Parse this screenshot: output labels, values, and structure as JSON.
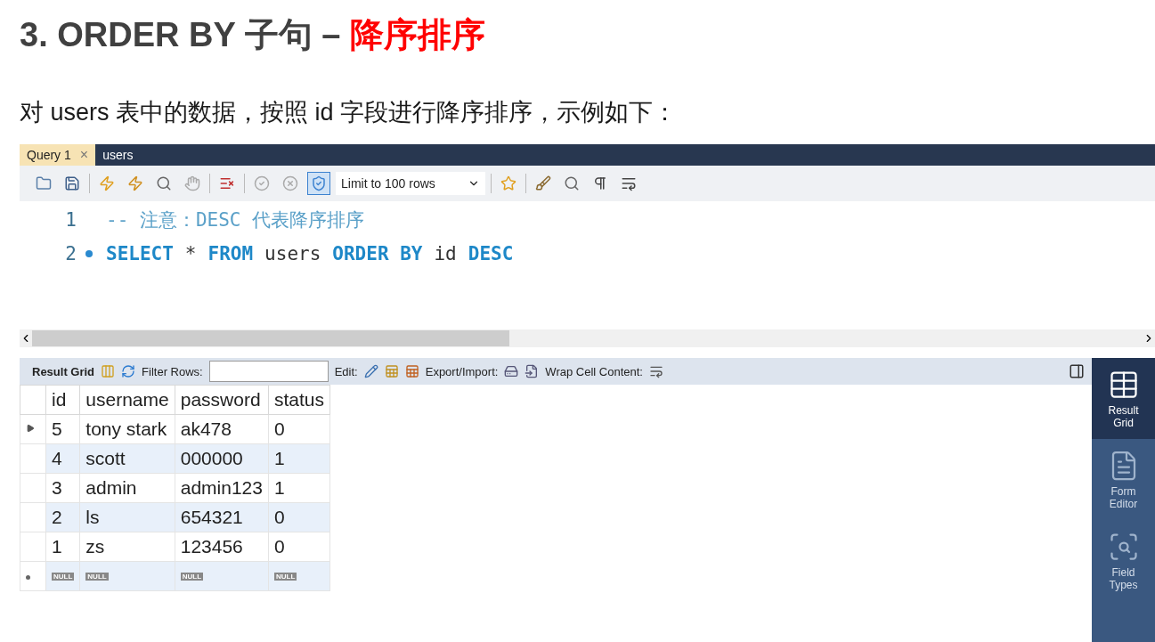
{
  "slide": {
    "title": [
      {
        "text": "3. ORDER BY 子句 – ",
        "kind": "normal"
      },
      {
        "text": "降序排序",
        "kind": "accent"
      }
    ],
    "subtitle": "对 users 表中的数据，按照 id 字段进行降序排序，示例如下："
  },
  "tabs": [
    {
      "label": "Query 1",
      "close": "×",
      "selected": true
    },
    {
      "label": "users",
      "selected": false
    }
  ],
  "toolbar": {
    "items": [
      {
        "kind": "button",
        "selected": false
      },
      {
        "kind": "button",
        "selected": false
      },
      {
        "kind": "separator"
      },
      {
        "kind": "button",
        "selected": false
      },
      {
        "kind": "button",
        "selected": false
      },
      {
        "kind": "button",
        "selected": false
      },
      {
        "kind": "button",
        "selected": false
      },
      {
        "kind": "separator"
      },
      {
        "kind": "button",
        "selected": false
      },
      {
        "kind": "separator"
      },
      {
        "kind": "button",
        "selected": false
      },
      {
        "kind": "button",
        "selected": false
      },
      {
        "kind": "button",
        "selected": true
      },
      {
        "kind": "dropdown",
        "label": "Limit to 100 rows"
      },
      {
        "kind": "separator"
      },
      {
        "kind": "button",
        "selected": false
      },
      {
        "kind": "separator"
      },
      {
        "kind": "button",
        "selected": false
      },
      {
        "kind": "button",
        "selected": false
      },
      {
        "kind": "button",
        "selected": false
      },
      {
        "kind": "button",
        "selected": false
      }
    ]
  },
  "editor": {
    "lines": [
      {
        "number": "1",
        "marker": false,
        "tokens": [
          {
            "text": "-- 注意：DESC 代表降序排序",
            "kind": "comment"
          }
        ]
      },
      {
        "number": "2",
        "marker": true,
        "tokens": [
          {
            "text": "SELECT",
            "kind": "keyword"
          },
          {
            "text": "*",
            "kind": "plain"
          },
          {
            "text": "FROM",
            "kind": "keyword"
          },
          {
            "text": "users",
            "kind": "plain"
          },
          {
            "text": "ORDER BY",
            "kind": "keyword"
          },
          {
            "text": "id",
            "kind": "plain"
          },
          {
            "text": "DESC",
            "kind": "keyword"
          }
        ]
      }
    ]
  },
  "result_toolbar": {
    "result_grid": "Result Grid",
    "filter_label": "Filter Rows:",
    "edit_label": "Edit:",
    "export_label": "Export/Import:",
    "wrap_label": "Wrap Cell Content:"
  },
  "table": {
    "columns": [
      "id",
      "username",
      "password",
      "status"
    ],
    "rows": [
      {
        "kind": "data",
        "current": true,
        "cells": [
          "5",
          "tony stark",
          "ak478",
          "0"
        ]
      },
      {
        "kind": "data",
        "current": false,
        "cells": [
          "4",
          "scott",
          "000000",
          "1"
        ]
      },
      {
        "kind": "data",
        "current": false,
        "cells": [
          "3",
          "admin",
          "admin123",
          "1"
        ]
      },
      {
        "kind": "data",
        "current": false,
        "cells": [
          "2",
          "ls",
          "654321",
          "0"
        ]
      },
      {
        "kind": "data",
        "current": false,
        "cells": [
          "1",
          "zs",
          "123456",
          "0"
        ]
      },
      {
        "kind": "new",
        "current": false,
        "cells": [
          "NULL",
          "NULL",
          "NULL",
          "NULL"
        ]
      }
    ]
  },
  "side_panel": [
    {
      "label": "Result Grid",
      "selected": true
    },
    {
      "label": "Form Editor",
      "selected": false
    },
    {
      "label": "Field Types",
      "selected": false
    }
  ]
}
